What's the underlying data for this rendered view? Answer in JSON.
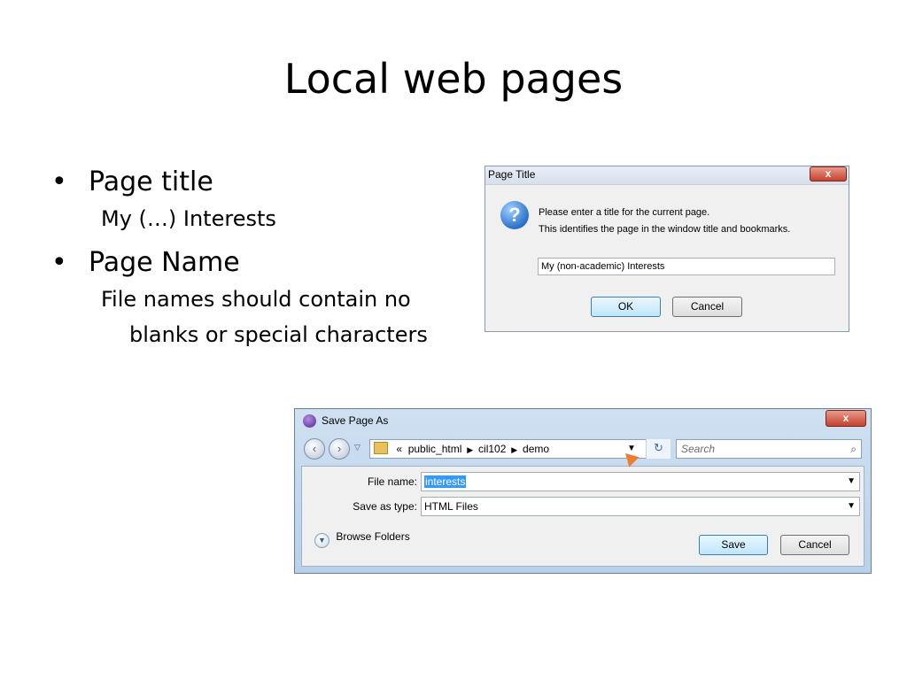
{
  "slide": {
    "title": "Local web pages",
    "bullets": [
      {
        "text": "Page title",
        "sub": "My (…) Interests"
      },
      {
        "text": "Page Name",
        "sub": "File names should contain no blanks or special characters"
      }
    ]
  },
  "page_title_dialog": {
    "title": "Page Title",
    "close_label": "x",
    "icon": "question-icon",
    "message_line1": "Please enter a title for the current page.",
    "message_line2": "This identifies the page in the window title and bookmarks.",
    "input_value": "My (non-academic) Interests",
    "ok_label": "OK",
    "cancel_label": "Cancel"
  },
  "save_dialog": {
    "title": "Save Page As",
    "close_label": "x",
    "breadcrumb": [
      "«",
      "public_html",
      "cil102",
      "demo"
    ],
    "search_placeholder": "Search",
    "file_name_label": "File name:",
    "file_name_value": "interests",
    "save_as_type_label": "Save as type:",
    "save_as_type_value": "HTML Files",
    "browse_folders_label": "Browse Folders",
    "save_label": "Save",
    "cancel_label": "Cancel"
  },
  "colors": {
    "accent_blue": "#3399ff",
    "close_red": "#c5422e",
    "cursor_orange": "#f07d2f"
  }
}
